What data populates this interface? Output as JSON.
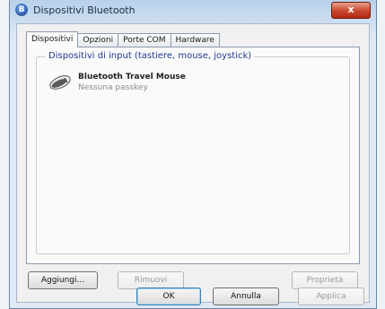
{
  "window": {
    "title": "Dispositivi Bluetooth",
    "close_label": "x"
  },
  "tabs": [
    {
      "label": "Dispositivi",
      "active": true
    },
    {
      "label": "Opzioni",
      "active": false
    },
    {
      "label": "Porte COM",
      "active": false
    },
    {
      "label": "Hardware",
      "active": false
    }
  ],
  "group": {
    "label": "Dispositivi di input (tastiere, mouse, joystick)",
    "devices": [
      {
        "name": "Bluetooth Travel Mouse",
        "status": "Nessuna passkey",
        "icon": "mouse-icon"
      }
    ]
  },
  "panel_buttons": {
    "add": "Aggiungi...",
    "remove": "Rimuovi",
    "properties": "Proprietà"
  },
  "dialog_buttons": {
    "ok": "OK",
    "cancel": "Annulla",
    "apply": "Applica"
  }
}
